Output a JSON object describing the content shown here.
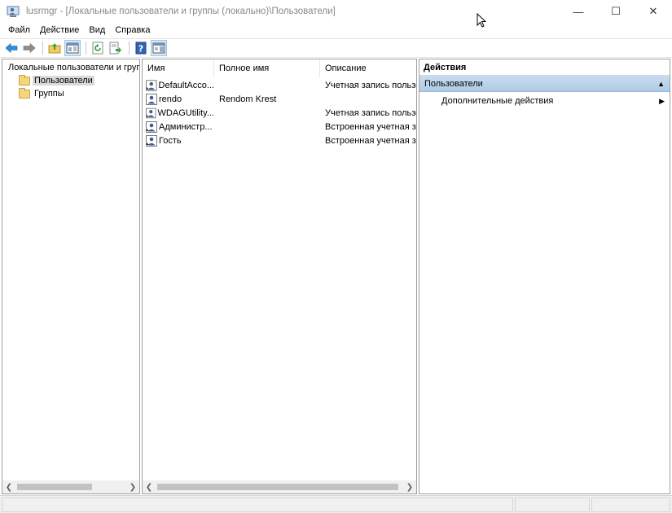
{
  "window": {
    "title": "lusrmgr - [Локальные пользователи и группы (локально)\\Пользователи]",
    "icon": "users-console-icon",
    "controls": {
      "minimize": "—",
      "maximize": "☐",
      "close": "✕"
    }
  },
  "menu": [
    "Файл",
    "Действие",
    "Вид",
    "Справка"
  ],
  "toolbar": {
    "buttons": [
      "back-icon",
      "forward-icon",
      "up-folder-icon",
      "show-hide-tree-icon",
      "refresh-icon",
      "export-list-icon",
      "help-icon",
      "show-hide-action-pane-icon"
    ]
  },
  "tree": {
    "root": "Локальные пользователи и группы (локально)",
    "items": [
      {
        "label": "Пользователи",
        "selected": true
      },
      {
        "label": "Группы",
        "selected": false
      }
    ]
  },
  "list": {
    "columns": [
      "Имя",
      "Полное имя",
      "Описание"
    ],
    "rows": [
      {
        "name": "DefaultAcco...",
        "full_name": "",
        "description": "Учетная запись пользо"
      },
      {
        "name": "rendo",
        "full_name": "Rendom Krest",
        "description": ""
      },
      {
        "name": "WDAGUtility...",
        "full_name": "",
        "description": "Учетная запись пользо"
      },
      {
        "name": "Администр...",
        "full_name": "",
        "description": "Встроенная учетная зап"
      },
      {
        "name": "Гость",
        "full_name": "",
        "description": "Встроенная учетная зап"
      }
    ]
  },
  "actions": {
    "title": "Действия",
    "section": "Пользователи",
    "items": [
      "Дополнительные действия"
    ]
  },
  "colors": {
    "section_bg": "#b9d3ec",
    "selected_tree_bg": "#d9d9d9",
    "pane_border": "#a0a0a0"
  }
}
